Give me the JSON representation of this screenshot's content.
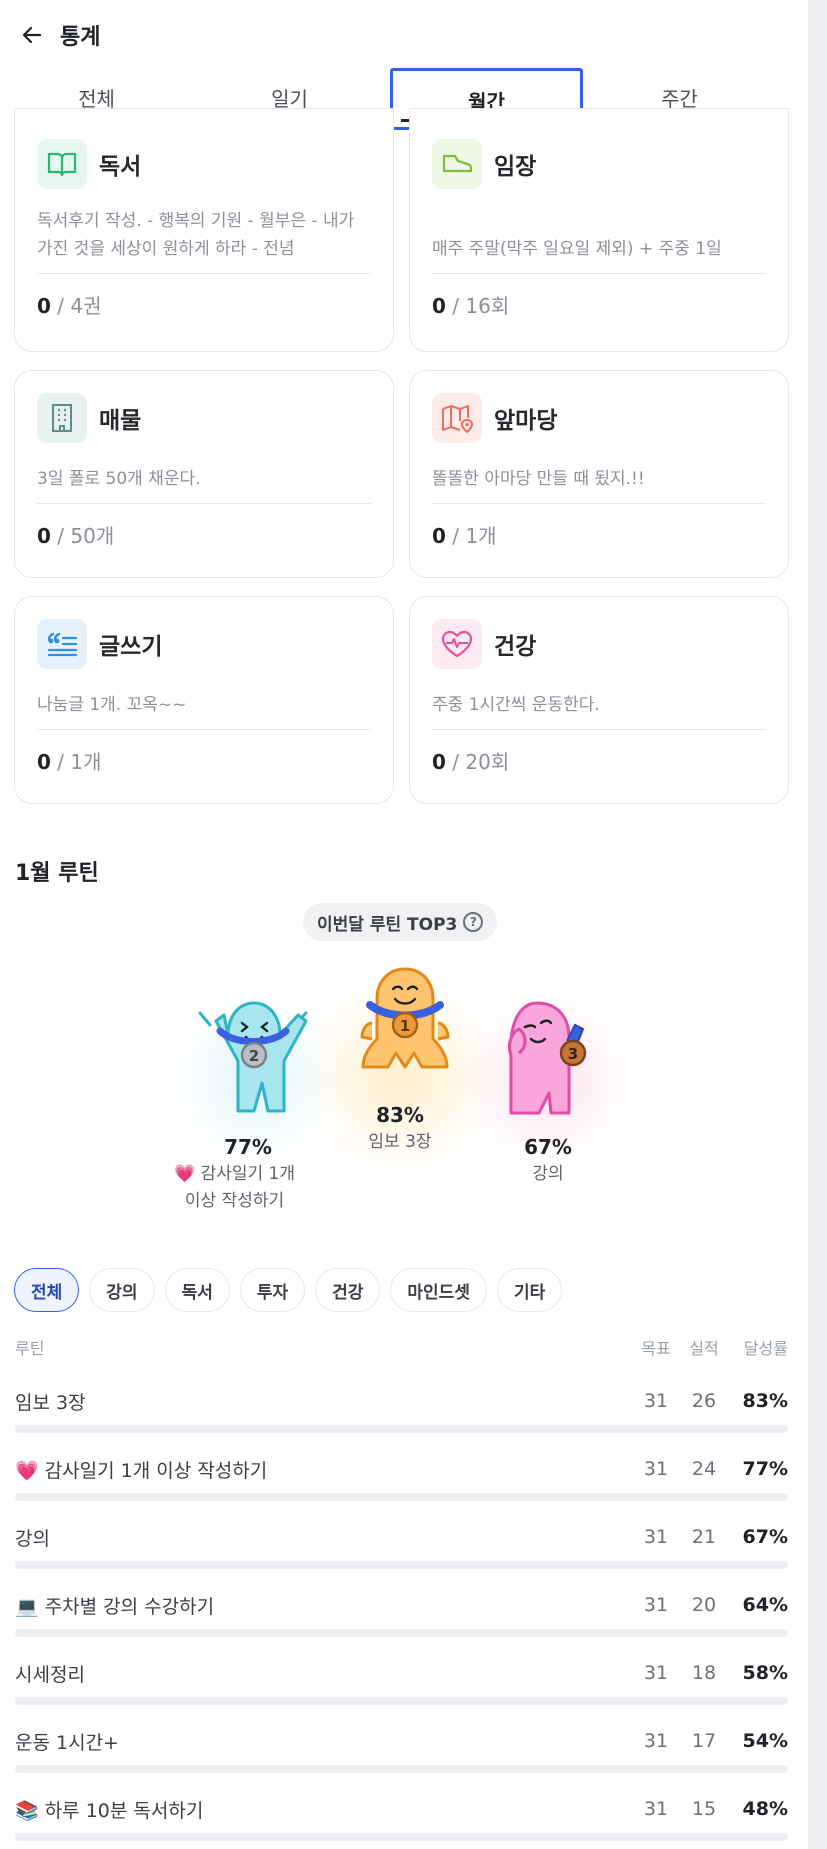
{
  "header": {
    "title": "통계"
  },
  "tabs": [
    {
      "label": "전체"
    },
    {
      "label": "일기"
    },
    {
      "label": "월간"
    },
    {
      "label": "주간"
    }
  ],
  "goals": [
    {
      "name": "독서",
      "icon": "book-icon",
      "desc": "독서후기 작성. - 행복의 기원 - 월부은 - 내가 가진 것을 세상이 원하게 하라 - 전념",
      "current": "0",
      "target": " / 4권",
      "accent": "#2bb673",
      "bg": "#e6f8ef"
    },
    {
      "name": "임장",
      "icon": "shoe-icon",
      "desc": "매주 주말(막주 일요일 제외) + 주중 1일",
      "current": "0",
      "target": " / 16회",
      "accent": "#7bbf3a",
      "bg": "#eff8e3"
    },
    {
      "name": "매물",
      "icon": "building-icon",
      "desc": "3일 폴로 50개 채운다.",
      "current": "0",
      "target": " / 50개",
      "accent": "#5a8f86",
      "bg": "#e7f1ef"
    },
    {
      "name": "앞마당",
      "icon": "map-pin-icon",
      "desc": "똘똘한 아마당 만들 때 됬지.!!",
      "current": "0",
      "target": " / 1개",
      "accent": "#ef6b5b",
      "bg": "#fdecea"
    },
    {
      "name": "글쓰기",
      "icon": "quote-icon",
      "desc": "나눔글 1개. 꼬옥~~",
      "current": "0",
      "target": " / 1개",
      "accent": "#2f8fe0",
      "bg": "#e5f2fc"
    },
    {
      "name": "건강",
      "icon": "heart-pulse-icon",
      "desc": "주중 1시간씩 운동한다.",
      "current": "0",
      "target": " / 20회",
      "accent": "#e4529b",
      "bg": "#fce9f2"
    }
  ],
  "routine": {
    "section_title": "1월 루틴",
    "top3_label": "이번달 루틴 TOP3",
    "top3": [
      {
        "rank": "1",
        "pct": "83%",
        "label": "임보 3장",
        "color": "#f7a53a"
      },
      {
        "rank": "2",
        "pct": "77%",
        "label": "💗 감사일기 1개 이상 작성하기",
        "color": "#7fd5e2"
      },
      {
        "rank": "3",
        "pct": "67%",
        "label": "강의",
        "color": "#f17cc3"
      }
    ],
    "filters": [
      "전체",
      "강의",
      "독서",
      "투자",
      "건강",
      "마인드셋",
      "기타"
    ],
    "table_headers": {
      "name": "루틴",
      "goal": "목표",
      "done": "실적",
      "rate": "달성률"
    },
    "rows": [
      {
        "name": "임보 3장",
        "goal": "31",
        "done": "26",
        "rate": "83%",
        "fraction": 0.83
      },
      {
        "name": "💗 감사일기 1개 이상 작성하기",
        "goal": "31",
        "done": "24",
        "rate": "77%",
        "fraction": 0.77
      },
      {
        "name": "강의",
        "goal": "31",
        "done": "21",
        "rate": "67%",
        "fraction": 0.67
      },
      {
        "name": "💻 주차별 강의 수강하기",
        "goal": "31",
        "done": "20",
        "rate": "64%",
        "fraction": 0.64
      },
      {
        "name": "시세정리",
        "goal": "31",
        "done": "18",
        "rate": "58%",
        "fraction": 0.58
      },
      {
        "name": "운동 1시간+",
        "goal": "31",
        "done": "17",
        "rate": "54%",
        "fraction": 0.54
      },
      {
        "name": "📚 하루 10분 독서하기",
        "goal": "31",
        "done": "15",
        "rate": "48%",
        "fraction": 0.48
      }
    ]
  }
}
